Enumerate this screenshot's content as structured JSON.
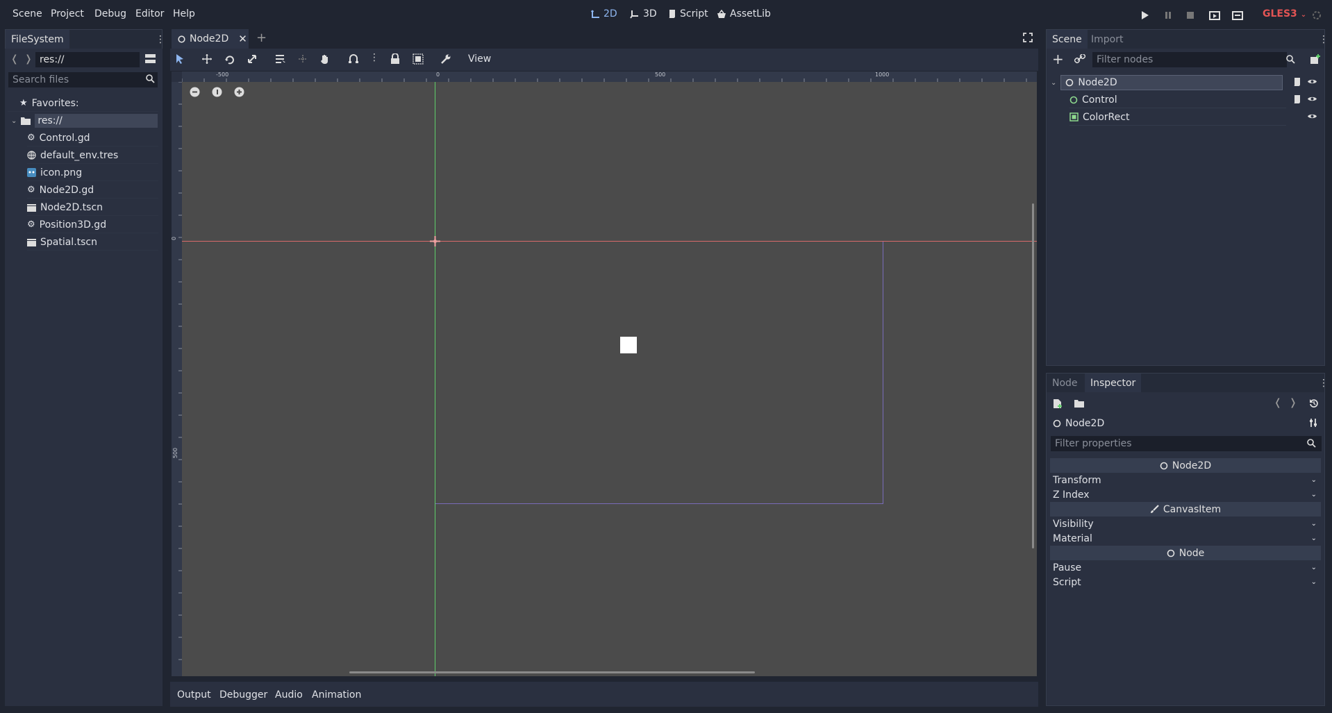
{
  "menu": {
    "scene": "Scene",
    "project": "Project",
    "debug": "Debug",
    "editor": "Editor",
    "help": "Help"
  },
  "modes": {
    "2d": "2D",
    "3d": "3D",
    "script": "Script",
    "assetlib": "AssetLib"
  },
  "renderer": "GLES3",
  "filesystem": {
    "tab": "FileSystem",
    "path": "res://",
    "search_placeholder": "Search files",
    "favorites": "Favorites:",
    "root": "res://",
    "files": [
      "Control.gd",
      "default_env.tres",
      "icon.png",
      "Node2D.gd",
      "Node2D.tscn",
      "Position3D.gd",
      "Spatial.tscn"
    ]
  },
  "editor_tab": {
    "label": "Node2D"
  },
  "toolbar": {
    "view": "View"
  },
  "ruler": {
    "top": [
      "-500",
      "0",
      "500",
      "1000"
    ],
    "left": [
      "0",
      "500"
    ]
  },
  "scene_panel": {
    "tabs": [
      "Scene",
      "Import"
    ],
    "filter_placeholder": "Filter nodes",
    "nodes": [
      "Node2D",
      "Control",
      "ColorRect"
    ]
  },
  "inspector": {
    "tabs": [
      "Node",
      "Inspector"
    ],
    "object": "Node2D",
    "filter_placeholder": "Filter properties",
    "sections": {
      "node2d": "Node2D",
      "transform": "Transform",
      "zindex": "Z Index",
      "canvasitem": "CanvasItem",
      "visibility": "Visibility",
      "material": "Material",
      "node": "Node",
      "pause": "Pause",
      "script": "Script"
    }
  },
  "bottom": {
    "output": "Output",
    "debugger": "Debugger",
    "audio": "Audio",
    "animation": "Animation"
  },
  "colors": {
    "accent": "#8eb6f0",
    "renderer": "#e35454",
    "viewport": "#4b4b4b"
  }
}
